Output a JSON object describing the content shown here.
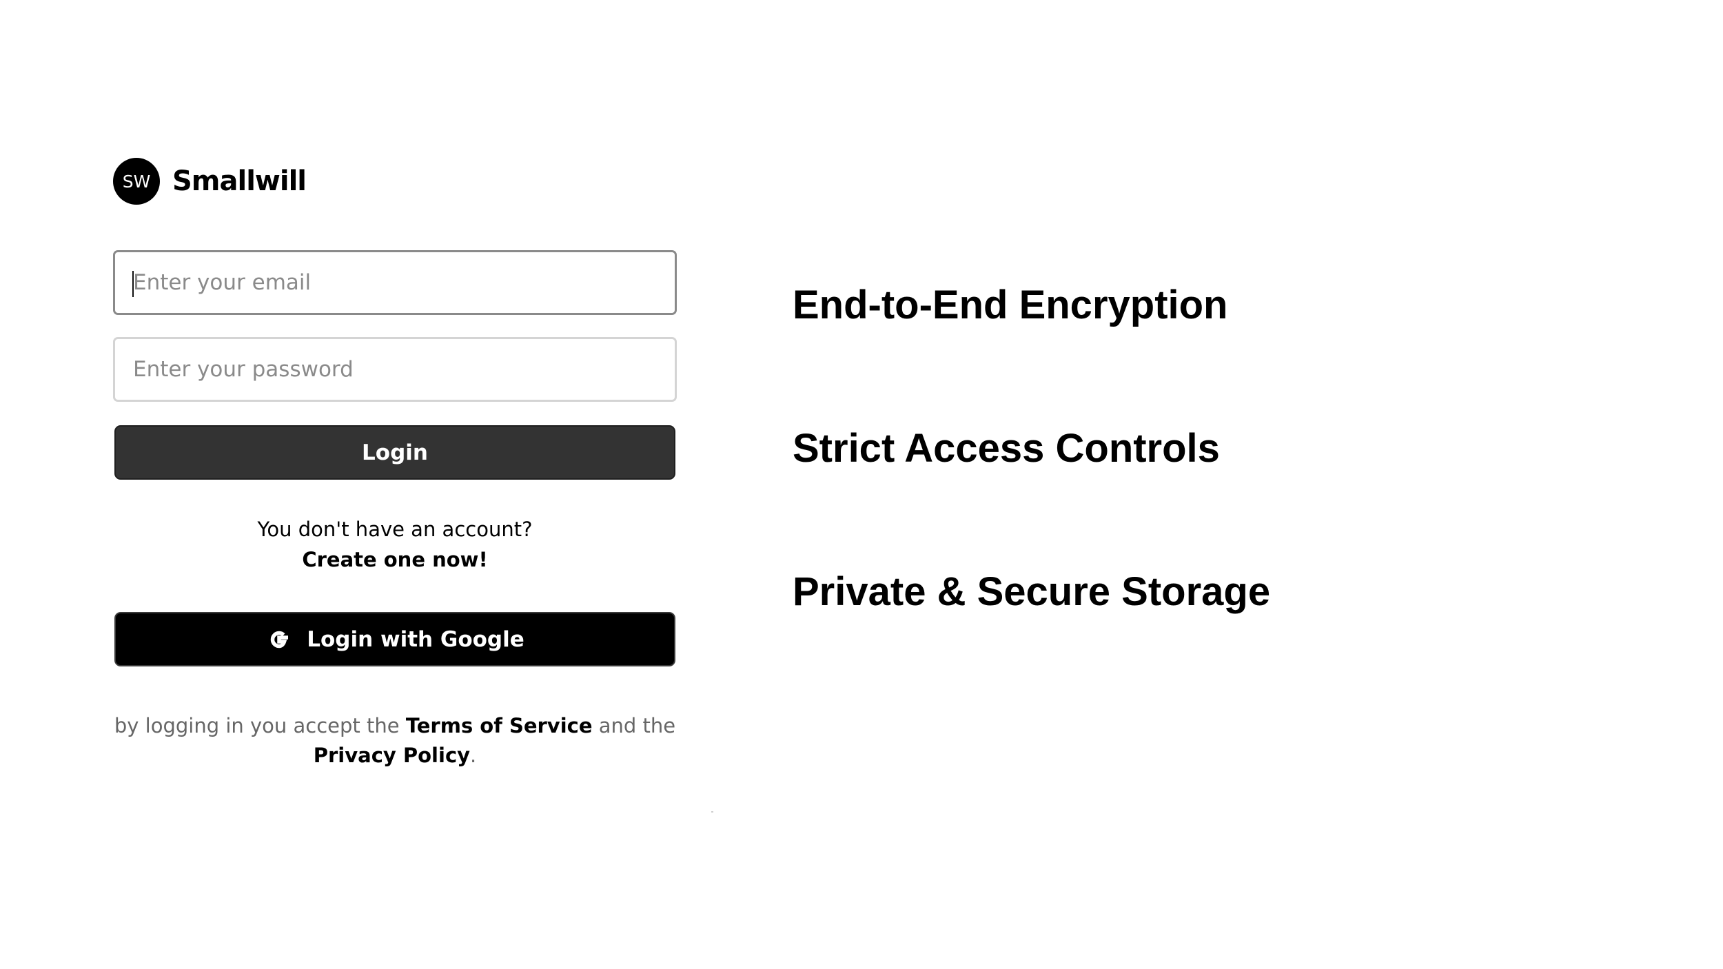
{
  "brand": {
    "logo_text": "SW",
    "name": "Smallwill"
  },
  "login_form": {
    "email_placeholder": "Enter your email",
    "password_placeholder": "Enter your password",
    "login_label": "Login",
    "signup_prompt": "You don't have an account?",
    "signup_link": "Create one now!",
    "google_label": "Login with Google",
    "google_icon": "google-g-icon"
  },
  "terms": {
    "prefix": "by logging in you accept the ",
    "terms_link": "Terms of Service",
    "middle": " and the",
    "privacy_link": "Privacy Policy",
    "suffix": "."
  },
  "features": [
    "End-to-End Encryption",
    "Strict Access Controls",
    "Private & Secure Storage"
  ],
  "colors": {
    "login_button": "#333333",
    "google_button": "#000000",
    "muted_text": "#666666"
  }
}
